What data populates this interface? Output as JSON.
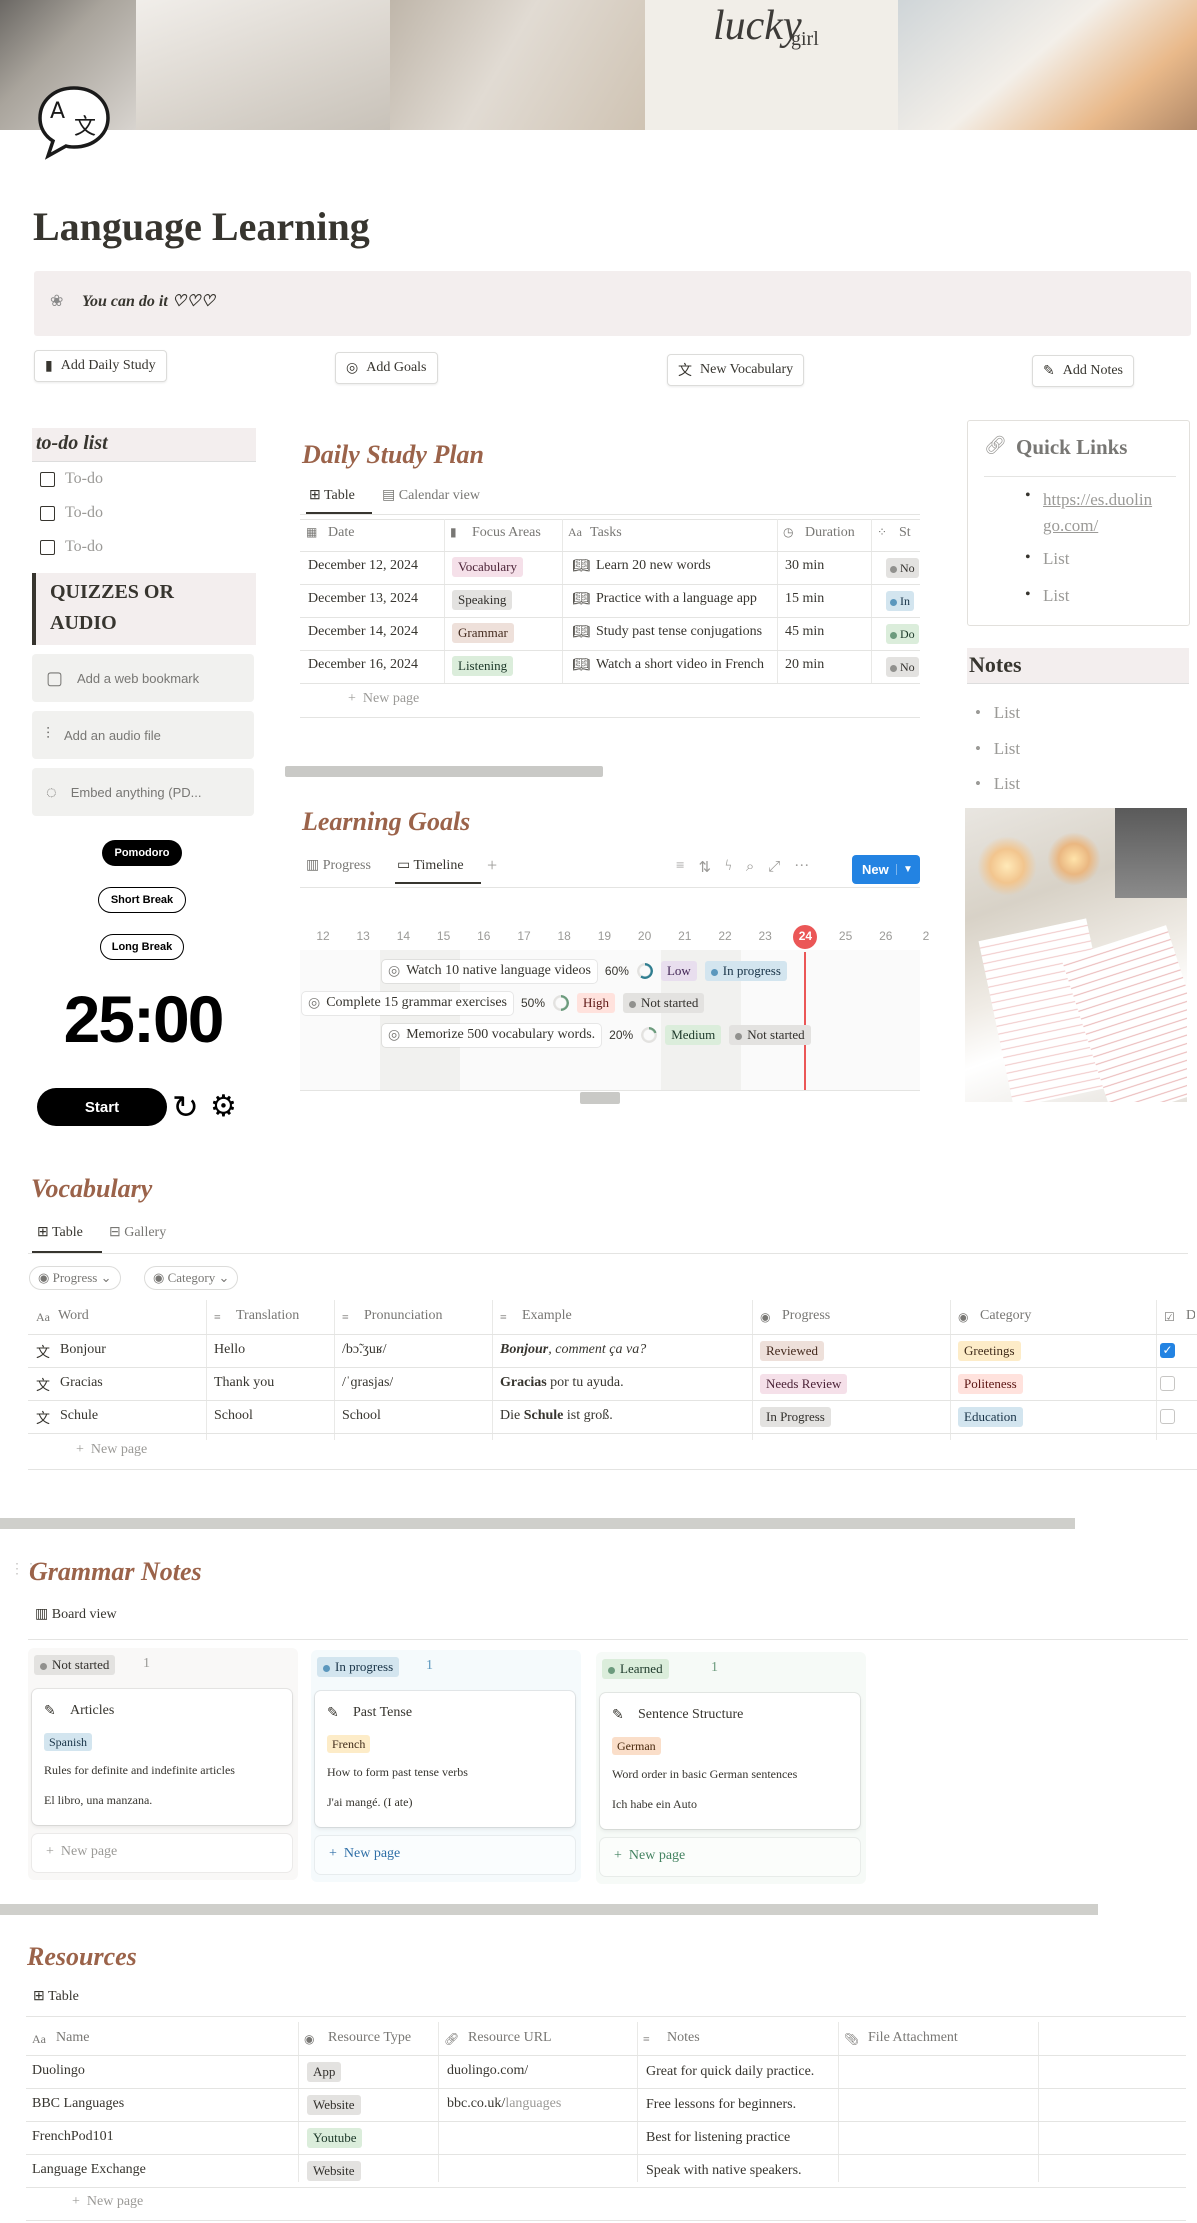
{
  "cover": {
    "lucky_text": "lucky",
    "girl_text": "girl"
  },
  "page_title": "Language Learning",
  "callout": {
    "text": "You can do it ♡♡♡"
  },
  "buttons": {
    "add_daily_study": "Add Daily Study",
    "add_goals": "Add Goals",
    "new_vocabulary": "New Vocabulary",
    "add_notes": "Add Notes"
  },
  "todo": {
    "title": "to-do list",
    "items": [
      "To-do",
      "To-do",
      "To-do"
    ]
  },
  "quizzes": {
    "title": "QUIZZES OR AUDIO",
    "embeds": [
      "Add a web bookmark",
      "Add an audio file",
      "Embed anything (PD..."
    ]
  },
  "timer": {
    "modes": [
      "Pomodoro",
      "Short Break",
      "Long Break"
    ],
    "time": "25:00",
    "start": "Start"
  },
  "daily_study": {
    "title": "Daily Study Plan",
    "views": [
      "Table",
      "Calendar view"
    ],
    "columns": [
      "Date",
      "Focus Areas",
      "Tasks",
      "Duration",
      "St"
    ],
    "rows": [
      {
        "date": "December 12, 2024",
        "area": "Vocabulary",
        "task": "Learn 20 new words",
        "duration": "30 min",
        "status": "No"
      },
      {
        "date": "December 13, 2024",
        "area": "Speaking",
        "task": "Practice with a language app",
        "duration": "15 min",
        "status": "In"
      },
      {
        "date": "December 14, 2024",
        "area": "Grammar",
        "task": "Study past tense conjugations",
        "duration": "45 min",
        "status": "Do"
      },
      {
        "date": "December 16, 2024",
        "area": "Listening",
        "task": "Watch a short video in French",
        "duration": "20 min",
        "status": "No"
      }
    ],
    "new_page": "New page",
    "area_colors": [
      "#f5e0e9",
      "#e3e2e0",
      "#eee0da",
      "#dbeddb"
    ]
  },
  "quick_links": {
    "title": "Quick Links",
    "link": "https://es.duolingo.com/",
    "link_line1": "https://es.duolin",
    "link_line2": "go.com/",
    "items": [
      "List",
      "List"
    ]
  },
  "notes": {
    "title": "Notes",
    "items": [
      "List",
      "List",
      "List"
    ]
  },
  "learning_goals": {
    "title": "Learning Goals",
    "views": [
      "Progress",
      "Timeline"
    ],
    "new_button": "New",
    "days": [
      "12",
      "13",
      "14",
      "15",
      "16",
      "17",
      "18",
      "19",
      "20",
      "21",
      "22",
      "23",
      "24",
      "25",
      "26",
      "2"
    ],
    "today": "24",
    "goals": [
      {
        "name": "Watch 10 native language videos",
        "pct": "60%",
        "priority": "Low",
        "status": "In progress"
      },
      {
        "name": "Complete 15 grammar exercises",
        "pct": "50%",
        "priority": "High",
        "status": "Not started"
      },
      {
        "name": "Memorize 500 vocabulary words.",
        "pct": "20%",
        "priority": "Medium",
        "status": "Not started"
      }
    ]
  },
  "vocabulary": {
    "title": "Vocabulary",
    "views": [
      "Table",
      "Gallery"
    ],
    "filters": [
      "Progress",
      "Category"
    ],
    "columns": [
      "Word",
      "Translation",
      "Pronunciation",
      "Example",
      "Progress",
      "Category",
      "Do"
    ],
    "rows": [
      {
        "word": "Bonjour",
        "translation": "Hello",
        "pron": "/bɔ̃.ʒuʁ/",
        "ex_bold": "Bonjour",
        "ex_rest": ", comment ça va?",
        "progress": "Reviewed",
        "category": "Greetings",
        "done": true
      },
      {
        "word": "Gracias",
        "translation": "Thank you",
        "pron": "/ˈɡrasjas/",
        "ex_bold": "Gracias",
        "ex_rest": " por tu ayuda.",
        "progress": "Needs Review",
        "category": "Politeness",
        "done": false
      },
      {
        "word": "Schule",
        "translation": "School",
        "pron": "School",
        "ex_pre": "Die ",
        "ex_bold": "Schule",
        "ex_rest": " ist groß.",
        "progress": "In Progress",
        "category": "Education",
        "done": false
      }
    ],
    "new_page": "New page"
  },
  "grammar": {
    "title": "Grammar Notes",
    "view": "Board view",
    "columns": [
      {
        "status": "Not started",
        "count": "1",
        "card": "Articles",
        "lang": "Spanish",
        "desc": "Rules for definite and indefinite articles",
        "ex": "El libro, una manzana.",
        "new_page": "New page"
      },
      {
        "status": "In progress",
        "count": "1",
        "card": "Past Tense",
        "lang": "French",
        "desc": "How to form past tense verbs",
        "ex": "J'ai mangé. (I ate)",
        "new_page": "New page"
      },
      {
        "status": "Learned",
        "count": "1",
        "card": "Sentence Structure",
        "lang": "German",
        "desc": "Word order in basic German sentences",
        "ex": "Ich habe ein Auto",
        "new_page": "New page"
      }
    ]
  },
  "resources": {
    "title": "Resources",
    "view": "Table",
    "columns": [
      "Name",
      "Resource Type",
      "Resource URL",
      "Notes",
      "File Attachment"
    ],
    "rows": [
      {
        "name": "Duolingo",
        "type": "App",
        "url": "duolingo.com/",
        "notes": "Great for quick daily practice."
      },
      {
        "name": "BBC Languages",
        "type": "Website",
        "url": "bbc.co.uk/languages",
        "notes": "Free lessons for beginners."
      },
      {
        "name": "FrenchPod101",
        "type": "Youtube",
        "url": "",
        "notes": "Best for listening practice"
      },
      {
        "name": "Language Exchange",
        "type": "Website",
        "url": "",
        "notes": "Speak with native speakers."
      }
    ],
    "new_page": "New page"
  }
}
